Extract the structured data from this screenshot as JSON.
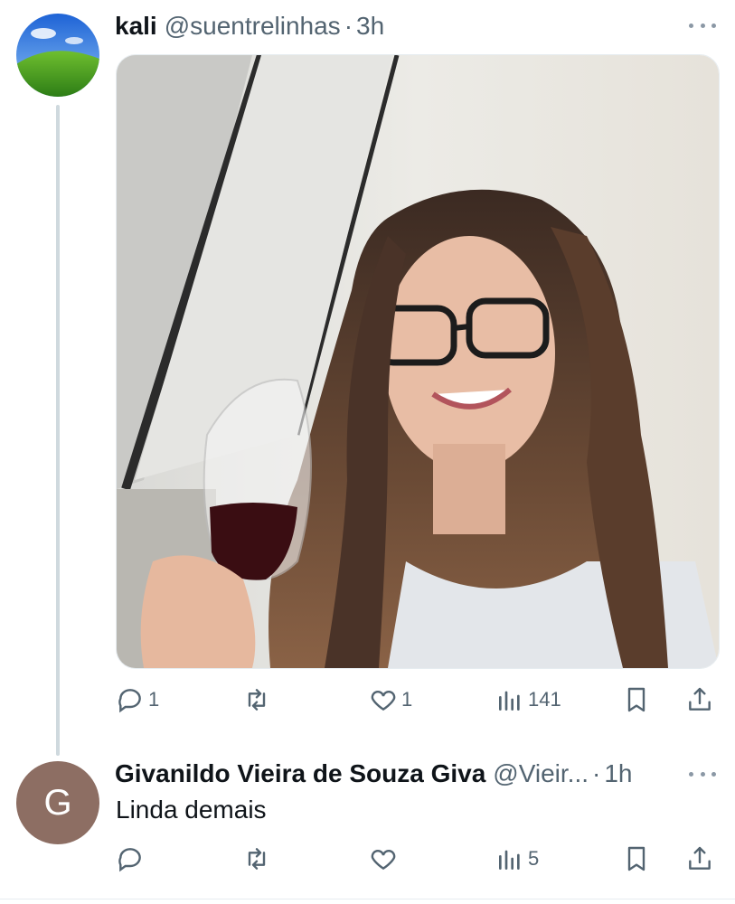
{
  "tweet": {
    "author_name": "kali",
    "author_handle": "@suentrelinhas",
    "separator": "·",
    "time": "3h",
    "avatar_icon": "windows-xp-bliss-avatar",
    "media_description_icon": "photo-woman-with-wine-glass",
    "actions": {
      "reply_count": "1",
      "retweet_count": "",
      "like_count": "1",
      "views_count": "141"
    }
  },
  "reply": {
    "avatar_letter": "G",
    "avatar_color": "#8d6e63",
    "author_name": "Givanildo Vieira de Souza Giva",
    "author_handle": "@Vieir...",
    "separator": "·",
    "time": "1h",
    "text": "Linda demais",
    "actions": {
      "reply_count": "",
      "retweet_count": "",
      "like_count": "",
      "views_count": "5"
    }
  },
  "colors": {
    "primary_text": "#0f1419",
    "secondary_text": "#536471",
    "divider": "#cfd9de"
  }
}
